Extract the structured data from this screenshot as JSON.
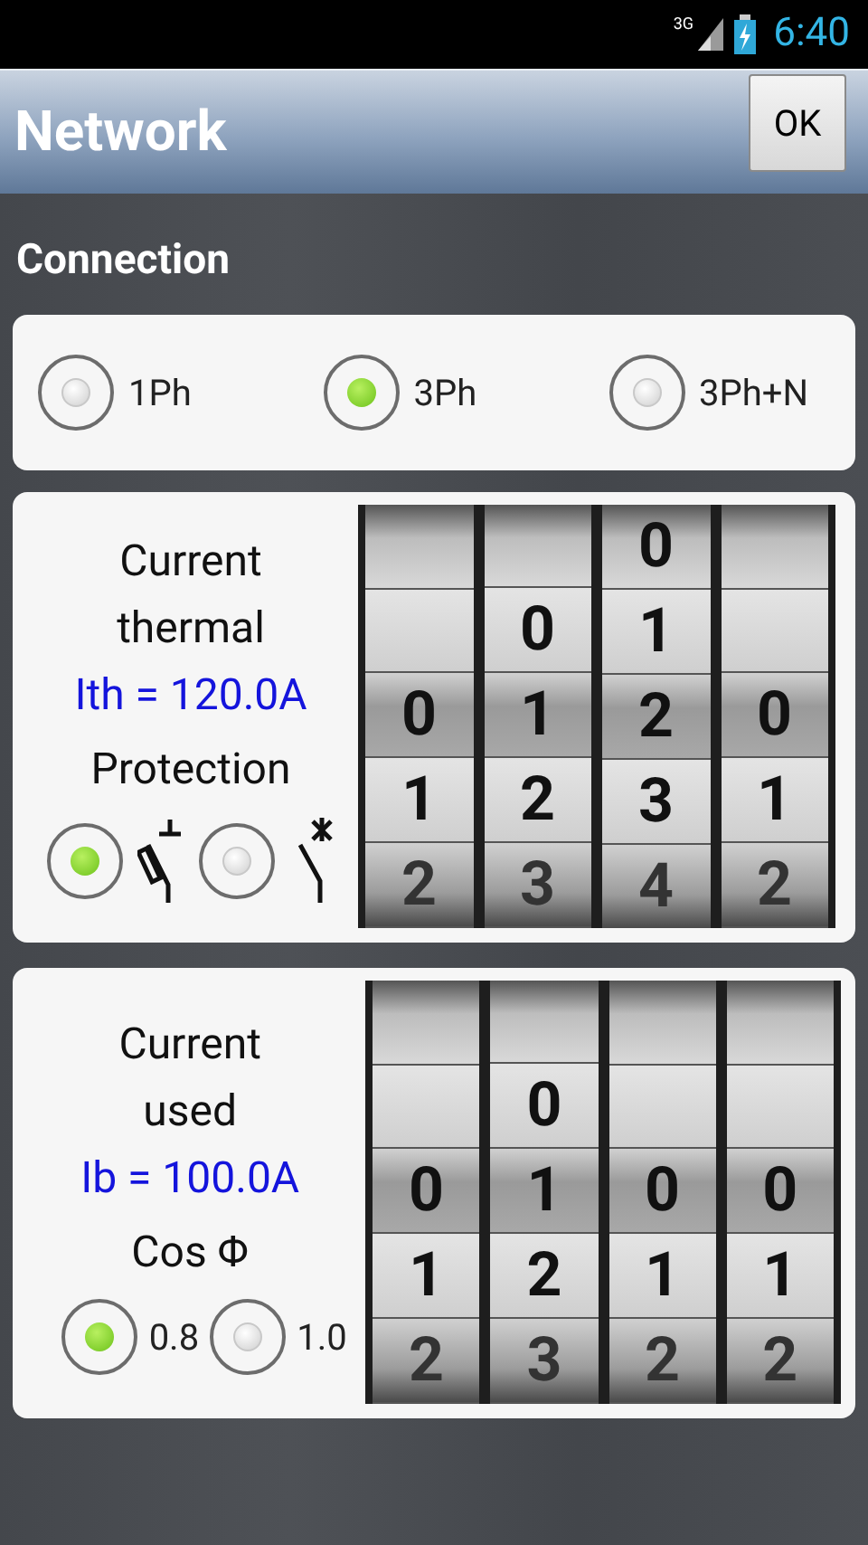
{
  "status_bar": {
    "network": "3G",
    "time": "6:40"
  },
  "header": {
    "title": "Network",
    "ok_button": "OK"
  },
  "connection": {
    "heading": "Connection",
    "options": [
      {
        "label": "1Ph",
        "selected": false
      },
      {
        "label": "3Ph",
        "selected": true
      },
      {
        "label": "3Ph+N",
        "selected": false
      }
    ]
  },
  "thermal": {
    "label": "Current thermal",
    "value": "Ith = 120.0A",
    "protection_label": "Protection",
    "protection_options": [
      {
        "kind": "fuse",
        "selected": true
      },
      {
        "kind": "breaker",
        "selected": false
      }
    ],
    "wheels": [
      {
        "current": "0",
        "below": [
          "1",
          "2"
        ]
      },
      {
        "above": [
          "0"
        ],
        "current": "1",
        "below": [
          "2",
          "3"
        ]
      },
      {
        "above": [
          "0",
          "1"
        ],
        "current": "2",
        "below": [
          "3",
          "4"
        ]
      },
      {
        "current": "0",
        "below": [
          "1",
          "2"
        ]
      }
    ]
  },
  "used": {
    "label": "Current used",
    "value": "Ib = 100.0A",
    "cos_label": "Cos Φ",
    "cos_options": [
      {
        "label": "0.8",
        "selected": true
      },
      {
        "label": "1.0",
        "selected": false
      }
    ],
    "wheels": [
      {
        "current": "0",
        "below": [
          "1",
          "2"
        ]
      },
      {
        "above": [
          "0"
        ],
        "current": "1",
        "below": [
          "2",
          "3"
        ]
      },
      {
        "current": "0",
        "below": [
          "1",
          "2"
        ]
      },
      {
        "current": "0",
        "below": [
          "1",
          "2"
        ]
      }
    ]
  }
}
